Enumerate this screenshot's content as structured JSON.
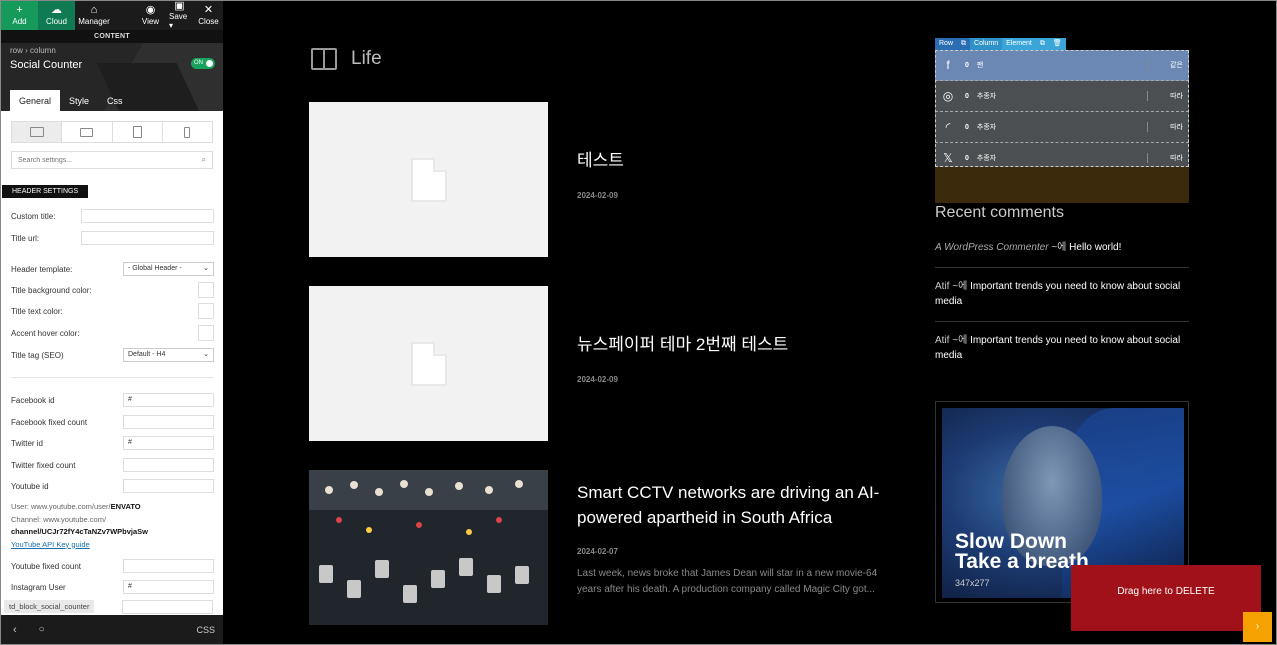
{
  "toolbar": {
    "add": "Add",
    "cloud": "Cloud",
    "manager": "Manager",
    "view": "View",
    "save": "Save ▾",
    "close": "Close",
    "content_label": "CONTENT"
  },
  "panel": {
    "breadcrumb": "row › column",
    "title": "Social Counter",
    "toggle": "ON",
    "tabs": [
      "General",
      "Style",
      "Css"
    ],
    "search_placeholder": "Search settings...",
    "section_header": "HEADER SETTINGS",
    "fields": {
      "custom_title": "Custom title:",
      "title_url": "Title url:",
      "header_template": "Header template:",
      "header_template_value": "- Global Header -",
      "title_bg_color": "Title background color:",
      "title_text_color": "Title text color:",
      "accent_hover_color": "Accent hover color:",
      "title_tag": "Title tag (SEO)",
      "title_tag_value": "Default - H4",
      "facebook_id": "Facebook id",
      "facebook_id_value": "#",
      "facebook_fixed": "Facebook fixed count",
      "twitter_id": "Twitter id",
      "twitter_id_value": "#",
      "twitter_fixed": "Twitter fixed count",
      "youtube_id": "Youtube id",
      "youtube_note_1": "User: www.youtube.com/user/",
      "youtube_note_1b": "ENVATO",
      "youtube_note_2": "Channel: www.youtube.com/",
      "youtube_note_3": "channel/UCJr72fY4cTaNZv7WPbvjaSw",
      "youtube_link": "YouTube API Key guide",
      "youtube_fixed": "Youtube fixed count",
      "instagram_user": "Instagram User",
      "instagram_user_value": "#"
    },
    "shortcode": "td_block_social_counter",
    "footer_css": "CSS"
  },
  "main": {
    "category": "Life",
    "posts": [
      {
        "title": "테스트",
        "date": "2024-02-09"
      },
      {
        "title": "뉴스페이퍼 테마 2번째 테스트",
        "date": "2024-02-09"
      },
      {
        "title": "Smart CCTV networks are driving an AI-powered apartheid in South Africa",
        "date": "2024-02-07",
        "excerpt": "Last week, news broke that James Dean will star in a new movie-64 years after his death. A production company called Magic City got..."
      }
    ]
  },
  "sidebar": {
    "element_bar": [
      "Row",
      "⧉",
      "Column",
      "Element",
      "⧉",
      "🗑"
    ],
    "social": [
      {
        "icon": "facebook-icon",
        "glyph": "f",
        "count": "0",
        "label": "팬",
        "action": "같은"
      },
      {
        "icon": "instagram-icon",
        "glyph": "◎",
        "count": "0",
        "label": "추종자",
        "action": "따라"
      },
      {
        "icon": "rss-icon",
        "glyph": "◜",
        "count": "0",
        "label": "추종자",
        "action": "따라"
      },
      {
        "icon": "x-icon",
        "glyph": "𝕏",
        "count": "0",
        "label": "추종자",
        "action": "따라"
      }
    ],
    "recent_title": "Recent comments",
    "comments": [
      {
        "author": "A WordPress Commenter",
        "sep": " ~에 ",
        "post": "Hello world!"
      },
      {
        "author": "Atif",
        "sep": " ~에 ",
        "post": "Important trends you need to know about social media"
      },
      {
        "author": "Atif",
        "sep": " ~에 ",
        "post": "Important trends you need to know about social media"
      }
    ],
    "ad_text_1": "Slow Down",
    "ad_text_2": "Take a breath",
    "ad_size": "347x277"
  },
  "drop_delete": "Drag here to DELETE",
  "colors": {
    "accent_green": "#159a5c",
    "delete_red": "#a0111a",
    "facebook_row": "#6b88b4"
  }
}
